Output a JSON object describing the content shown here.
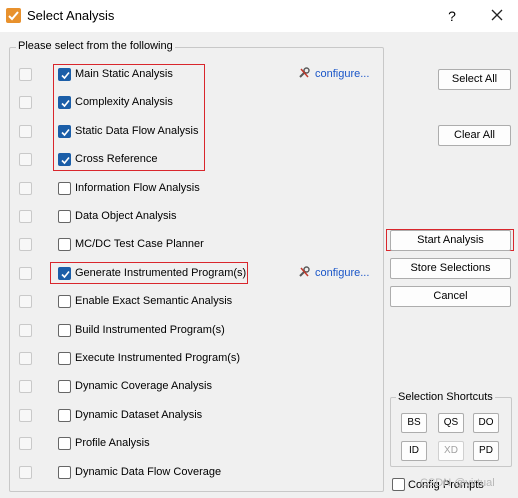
{
  "window": {
    "title": "Select Analysis",
    "help_label": "?"
  },
  "group": {
    "label": "Please select from the following"
  },
  "rows": [
    {
      "label": "Main Static Analysis",
      "checked": true,
      "configure": "configure..."
    },
    {
      "label": "Complexity Analysis",
      "checked": true
    },
    {
      "label": "Static Data Flow Analysis",
      "checked": true
    },
    {
      "label": "Cross Reference",
      "checked": true
    },
    {
      "label": "Information Flow Analysis",
      "checked": false
    },
    {
      "label": "Data Object Analysis",
      "checked": false
    },
    {
      "label": "MC/DC Test Case Planner",
      "checked": false
    },
    {
      "label": "Generate Instrumented Program(s)",
      "checked": true,
      "configure": "configure..."
    },
    {
      "label": "Enable Exact Semantic Analysis",
      "checked": false
    },
    {
      "label": "Build Instrumented Program(s)",
      "checked": false
    },
    {
      "label": "Execute Instrumented Program(s)",
      "checked": false
    },
    {
      "label": "Dynamic Coverage Analysis",
      "checked": false
    },
    {
      "label": "Dynamic Dataset Analysis",
      "checked": false
    },
    {
      "label": "Profile Analysis",
      "checked": false
    },
    {
      "label": "Dynamic Data Flow Coverage",
      "checked": false
    }
  ],
  "buttons": {
    "select_all": "Select All",
    "clear_all": "Clear All",
    "start_analysis": "Start Analysis",
    "store_selections": "Store Selections",
    "cancel": "Cancel"
  },
  "shortcuts": {
    "label": "Selection Shortcuts",
    "items": [
      {
        "label": "BS",
        "enabled": true
      },
      {
        "label": "QS",
        "enabled": true
      },
      {
        "label": "DO",
        "enabled": true
      },
      {
        "label": "ID",
        "enabled": true
      },
      {
        "label": "XD",
        "enabled": false
      },
      {
        "label": "PD",
        "enabled": true
      }
    ]
  },
  "config_prompts": {
    "label": "Config Prompts",
    "checked": false
  },
  "watermark": "CSDN @virtual",
  "colors": {
    "highlight_box": "#d9262c",
    "checkbox_checked": "#1b5ea8",
    "link": "#1a56c8"
  }
}
